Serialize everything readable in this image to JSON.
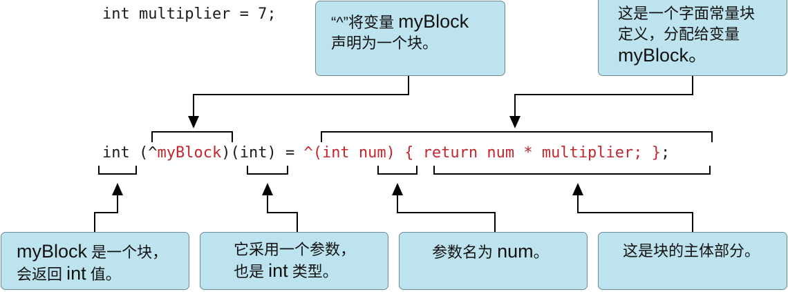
{
  "code_line1": "int multiplier = 7;",
  "code_line2": {
    "int_kw": "int",
    "open_caret": "(^",
    "name": "myBlock",
    "close_paren": ")",
    "param_type": "(int)",
    "equals": " = ",
    "literal_params": "^(int num)",
    "space": " ",
    "literal_body": "{ return num * multiplier; }",
    "semicolon": ";"
  },
  "callouts": {
    "caret": {
      "line1_a": "“^”将变量 ",
      "line1_b": "myBlock",
      "line2": "声明为一个块。"
    },
    "literal": {
      "line1": "这是一个字面常量块",
      "line2": "定义，分配给变量",
      "line3": "myBlock。"
    },
    "return_type": {
      "line1_a": "myBlock",
      "line1_b": " 是一个块，",
      "line2_a": "会返回 ",
      "line2_b": "int",
      "line2_c": " 值。"
    },
    "param": {
      "line1": "它采用一个参数，",
      "line2_a": "也是 ",
      "line2_b": "int",
      "line2_c": " 类型。"
    },
    "param_name": {
      "text_a": "参数名为 ",
      "text_b": "num",
      "text_c": "。"
    },
    "body": {
      "text": "这是块的主体部分。"
    }
  },
  "colors": {
    "box_fill": "#bde3ef",
    "box_border": "#6d8a94",
    "code_highlight": "#c1272d",
    "line": "#000000"
  }
}
